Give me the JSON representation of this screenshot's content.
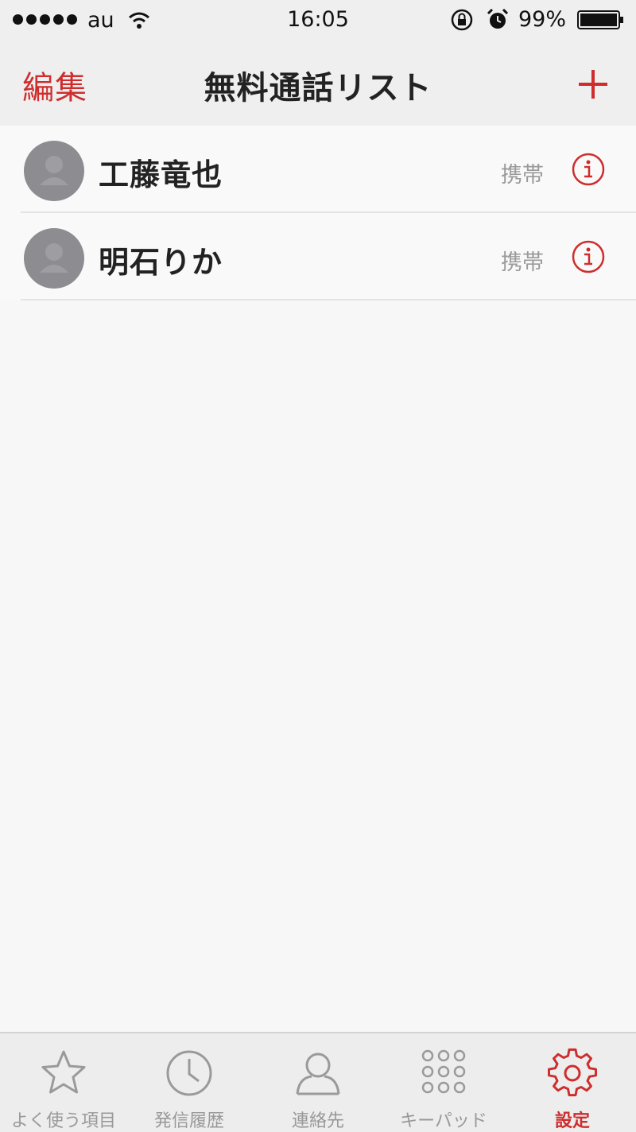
{
  "status_bar": {
    "carrier": "au",
    "time": "16:05",
    "battery": "99%"
  },
  "nav": {
    "edit_label": "編集",
    "title": "無料通話リスト",
    "add_icon": "plus-icon"
  },
  "contacts": [
    {
      "name": "工藤竜也",
      "type": "携帯"
    },
    {
      "name": "明石りか",
      "type": "携帯"
    }
  ],
  "tabs": [
    {
      "label": "よく使う項目",
      "icon": "star-icon",
      "active": false
    },
    {
      "label": "発信履歴",
      "icon": "clock-icon",
      "active": false
    },
    {
      "label": "連絡先",
      "icon": "person-icon",
      "active": false
    },
    {
      "label": "キーパッド",
      "icon": "keypad-icon",
      "active": false
    },
    {
      "label": "設定",
      "icon": "gear-icon",
      "active": true
    }
  ],
  "colors": {
    "accent": "#cf2d2d",
    "avatar": "#8c8c91",
    "secondary_text": "#9a9a9a"
  }
}
